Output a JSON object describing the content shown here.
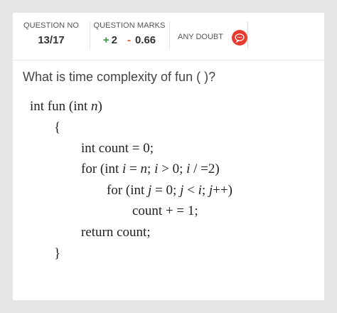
{
  "header": {
    "question_no_label": "QUESTION NO",
    "question_no_value": "13/17",
    "marks_label": "QUESTION MARKS",
    "marks_plus_sign": "+",
    "marks_plus_value": "2",
    "marks_minus_sign": "-",
    "marks_minus_value": "0.66",
    "doubt_label": "ANY DOUBT",
    "doubt_icon": "chat-bubble-icon",
    "colors": {
      "plus": "#2e9e3e",
      "minus": "#e05a2b",
      "doubt": "#e63b2e"
    }
  },
  "question": {
    "text": "What is time complexity of fun ( )?"
  },
  "code": {
    "l1_a": "int fun (int ",
    "l1_n": "n",
    "l1_b": ")",
    "l2": "{",
    "l3": "int count = 0;",
    "l4_a": "for (int ",
    "l4_i1": "i",
    "l4_b": " = ",
    "l4_n": "n",
    "l4_c": "; ",
    "l4_i2": "i",
    "l4_d": " > 0; ",
    "l4_i3": "i",
    "l4_e": " / =2)",
    "l5_a": "for (int ",
    "l5_j1": "j",
    "l5_b": " = 0; ",
    "l5_j2": "j",
    "l5_c": " < ",
    "l5_i": "i",
    "l5_d": "; ",
    "l5_j3": "j",
    "l5_e": "++)",
    "l6": "count + = 1;",
    "l7": "return count;",
    "l8": "}"
  }
}
